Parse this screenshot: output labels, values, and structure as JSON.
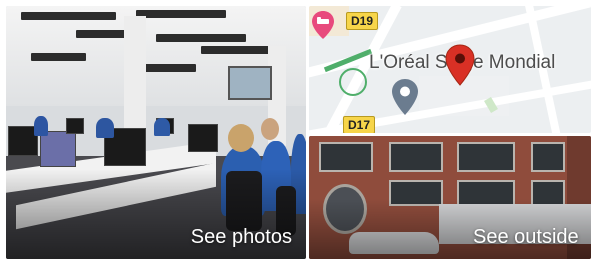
{
  "tiles": {
    "photos": {
      "caption": "See photos"
    },
    "map": {
      "place_label": "L'Oréal Siège Mondial",
      "road_badges": [
        "D19",
        "D17"
      ]
    },
    "outside": {
      "caption": "See outside"
    }
  },
  "colors": {
    "place_pin": "#d93025",
    "secondary_pin": "#6b7c8f",
    "pink_marker": "#e84a7d",
    "road_badge": "#f7d54a",
    "caption_text": "#ffffff"
  },
  "icons": {
    "place_pin": "map-pin-icon",
    "secondary_pin": "location-pin-icon",
    "pink_marker": "bed-marker-icon"
  }
}
